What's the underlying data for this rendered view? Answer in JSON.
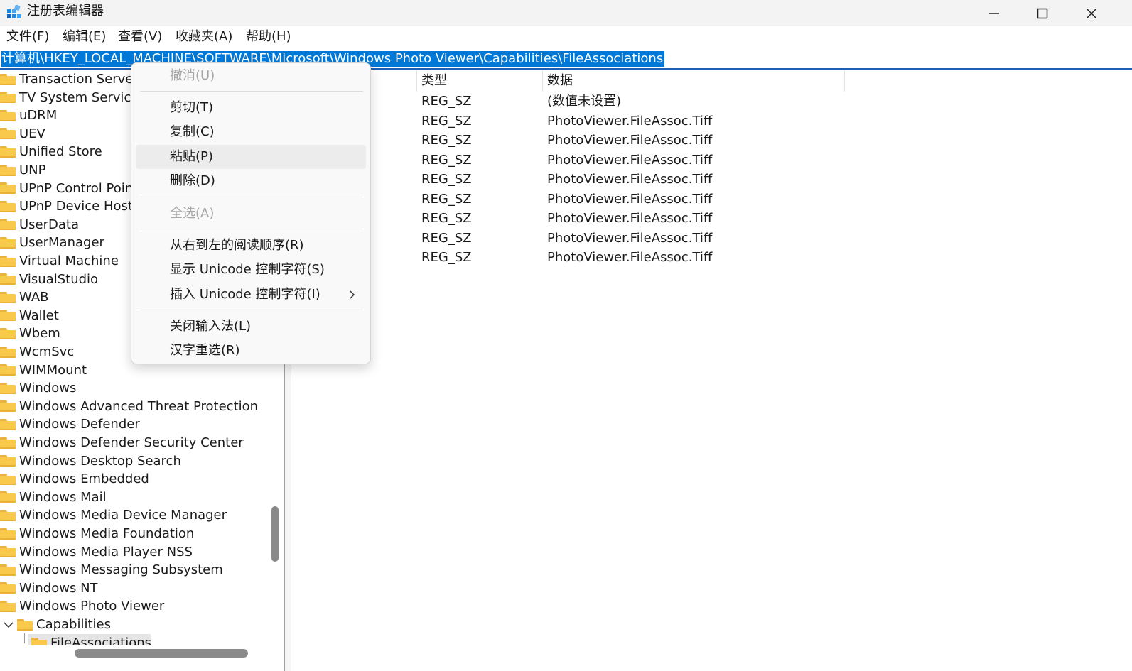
{
  "window": {
    "title": "注册表编辑器",
    "minimize_icon": "minimize-icon",
    "maximize_icon": "maximize-icon",
    "close_icon": "close-icon"
  },
  "menubar": [
    "文件(F)",
    "编辑(E)",
    "查看(V)",
    "收藏夹(A)",
    "帮助(H)"
  ],
  "address": {
    "path": "计算机\\HKEY_LOCAL_MACHINE\\SOFTWARE\\Microsoft\\Windows Photo Viewer\\Capabilities\\FileAssociations",
    "selected": true
  },
  "tree": {
    "items": [
      "Transaction Server",
      "TV System Services",
      "uDRM",
      "UEV",
      "Unified Store",
      "UNP",
      "UPnP Control Point",
      "UPnP Device Host",
      "UserData",
      "UserManager",
      "Virtual Machine",
      "VisualStudio",
      "WAB",
      "Wallet",
      "Wbem",
      "WcmSvc",
      "WIMMount",
      "Windows",
      "Windows Advanced Threat Protection",
      "Windows Defender",
      "Windows Defender Security Center",
      "Windows Desktop Search",
      "Windows Embedded",
      "Windows Mail",
      "Windows Media Device Manager",
      "Windows Media Foundation",
      "Windows Media Player NSS",
      "Windows Messaging Subsystem",
      "Windows NT",
      "Windows Photo Viewer"
    ],
    "expanded_child": "Capabilities",
    "selected_child": "FileAssociations"
  },
  "list": {
    "headers": {
      "type": "类型",
      "data": "数据"
    },
    "rows": [
      {
        "type": "REG_SZ",
        "data": "(数值未设置)"
      },
      {
        "type": "REG_SZ",
        "data": "PhotoViewer.FileAssoc.Tiff"
      },
      {
        "type": "REG_SZ",
        "data": "PhotoViewer.FileAssoc.Tiff"
      },
      {
        "type": "REG_SZ",
        "data": "PhotoViewer.FileAssoc.Tiff"
      },
      {
        "type": "REG_SZ",
        "data": "PhotoViewer.FileAssoc.Tiff"
      },
      {
        "type": "REG_SZ",
        "data": "PhotoViewer.FileAssoc.Tiff"
      },
      {
        "type": "REG_SZ",
        "data": "PhotoViewer.FileAssoc.Tiff"
      },
      {
        "type": "REG_SZ",
        "data": "PhotoViewer.FileAssoc.Tiff"
      },
      {
        "type": "REG_SZ",
        "data": "PhotoViewer.FileAssoc.Tiff"
      }
    ]
  },
  "context_menu": {
    "undo": "撤消(U)",
    "cut": "剪切(T)",
    "copy": "复制(C)",
    "paste": "粘贴(P)",
    "delete": "删除(D)",
    "select_all": "全选(A)",
    "rtl": "从右到左的阅读顺序(R)",
    "show_unicode": "显示 Unicode 控制字符(S)",
    "insert_unicode": "插入 Unicode 控制字符(I)",
    "close_ime": "关闭输入法(L)",
    "reconversion": "汉字重选(R)",
    "submenu_icon": "chevron-right-icon"
  },
  "colors": {
    "selection_blue": "#0078d7",
    "folder_yellow": "#f8c94a",
    "titlebar_bg": "#f3f3f3"
  }
}
